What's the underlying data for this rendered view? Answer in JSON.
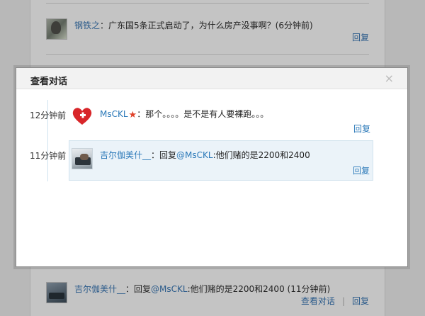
{
  "feed": {
    "items": [
      {
        "name": "钢铁之",
        "text": "：广东国5条正式启动了，为什么房产没事啊？(6分钟前)",
        "actions": [
          "回复"
        ]
      },
      {
        "name": "吉尔伽美什__",
        "text_pre": "：回复",
        "mention": "@MsCKL",
        "text_post": ":他们赌的是2200和2400 (11分钟前)",
        "actions": [
          "查看对话",
          "回复"
        ]
      }
    ],
    "separator": "|"
  },
  "modal": {
    "title": "查看对话",
    "close": "×",
    "messages": [
      {
        "time": "12分钟前",
        "name": "MsCKL",
        "text": "：那个。。。。是不是有人要裸跑。。。",
        "reply": "回复"
      },
      {
        "time": "11分钟前",
        "name": "吉尔伽美什__",
        "text_pre": "：回复",
        "mention": "@MsCKL",
        "text_post": ":他们赌的是2200和2400",
        "reply": "回复"
      }
    ]
  },
  "colors": {
    "link": "#2a78b8",
    "highlight_bg": "#ebf3f9",
    "overlay": "#b8b8b8"
  }
}
